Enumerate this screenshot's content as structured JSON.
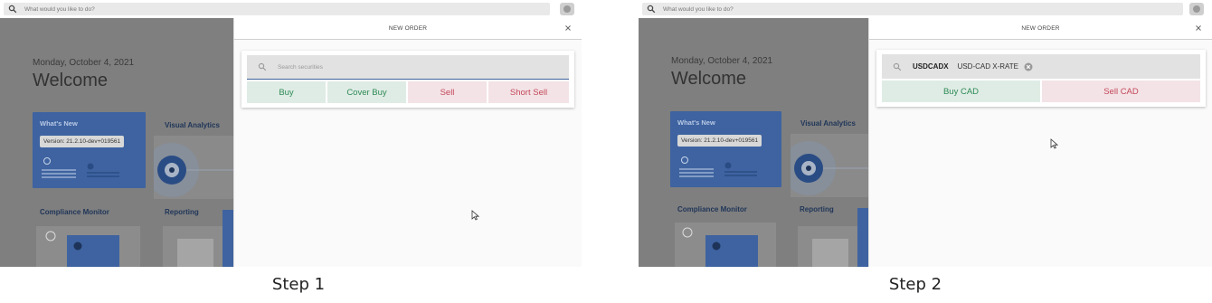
{
  "steps": [
    {
      "caption": "Step 1",
      "top_search": {
        "placeholder": "What would you like to do?"
      },
      "dashboard": {
        "date": "Monday, October 4, 2021",
        "welcome": "Welcome",
        "whats_new": {
          "title": "What's New",
          "version": "Version: 21.2.10-dev+019561"
        },
        "tiles": [
          "Visual Analytics",
          "Compliance Monitor",
          "Reporting"
        ]
      },
      "order_sheet": {
        "title": "NEW ORDER",
        "search_placeholder": "Search securities",
        "buttons": [
          "Buy",
          "Cover Buy",
          "Sell",
          "Short Sell"
        ]
      }
    },
    {
      "caption": "Step 2",
      "top_search": {
        "placeholder": "What would you like to do?"
      },
      "dashboard": {
        "date": "Monday, October 4, 2021",
        "welcome": "Welcome",
        "whats_new": {
          "title": "What's New",
          "version": "Version: 21.2.10-dev+019561"
        },
        "tiles": [
          "Visual Analytics",
          "Compliance Monitor",
          "Reporting"
        ]
      },
      "order_sheet": {
        "title": "NEW ORDER",
        "selected_security": {
          "ticker": "USDCADX",
          "description": "USD-CAD X-RATE"
        },
        "buttons": [
          "Buy CAD",
          "Sell CAD"
        ]
      }
    }
  ],
  "colors": {
    "buy": "#2d8a55",
    "sell": "#c4485a",
    "card_blue": "#3e63a0"
  },
  "icons": [
    "search-icon",
    "avatar-icon",
    "close-icon",
    "clear-icon",
    "mouse-cursor-icon"
  ]
}
